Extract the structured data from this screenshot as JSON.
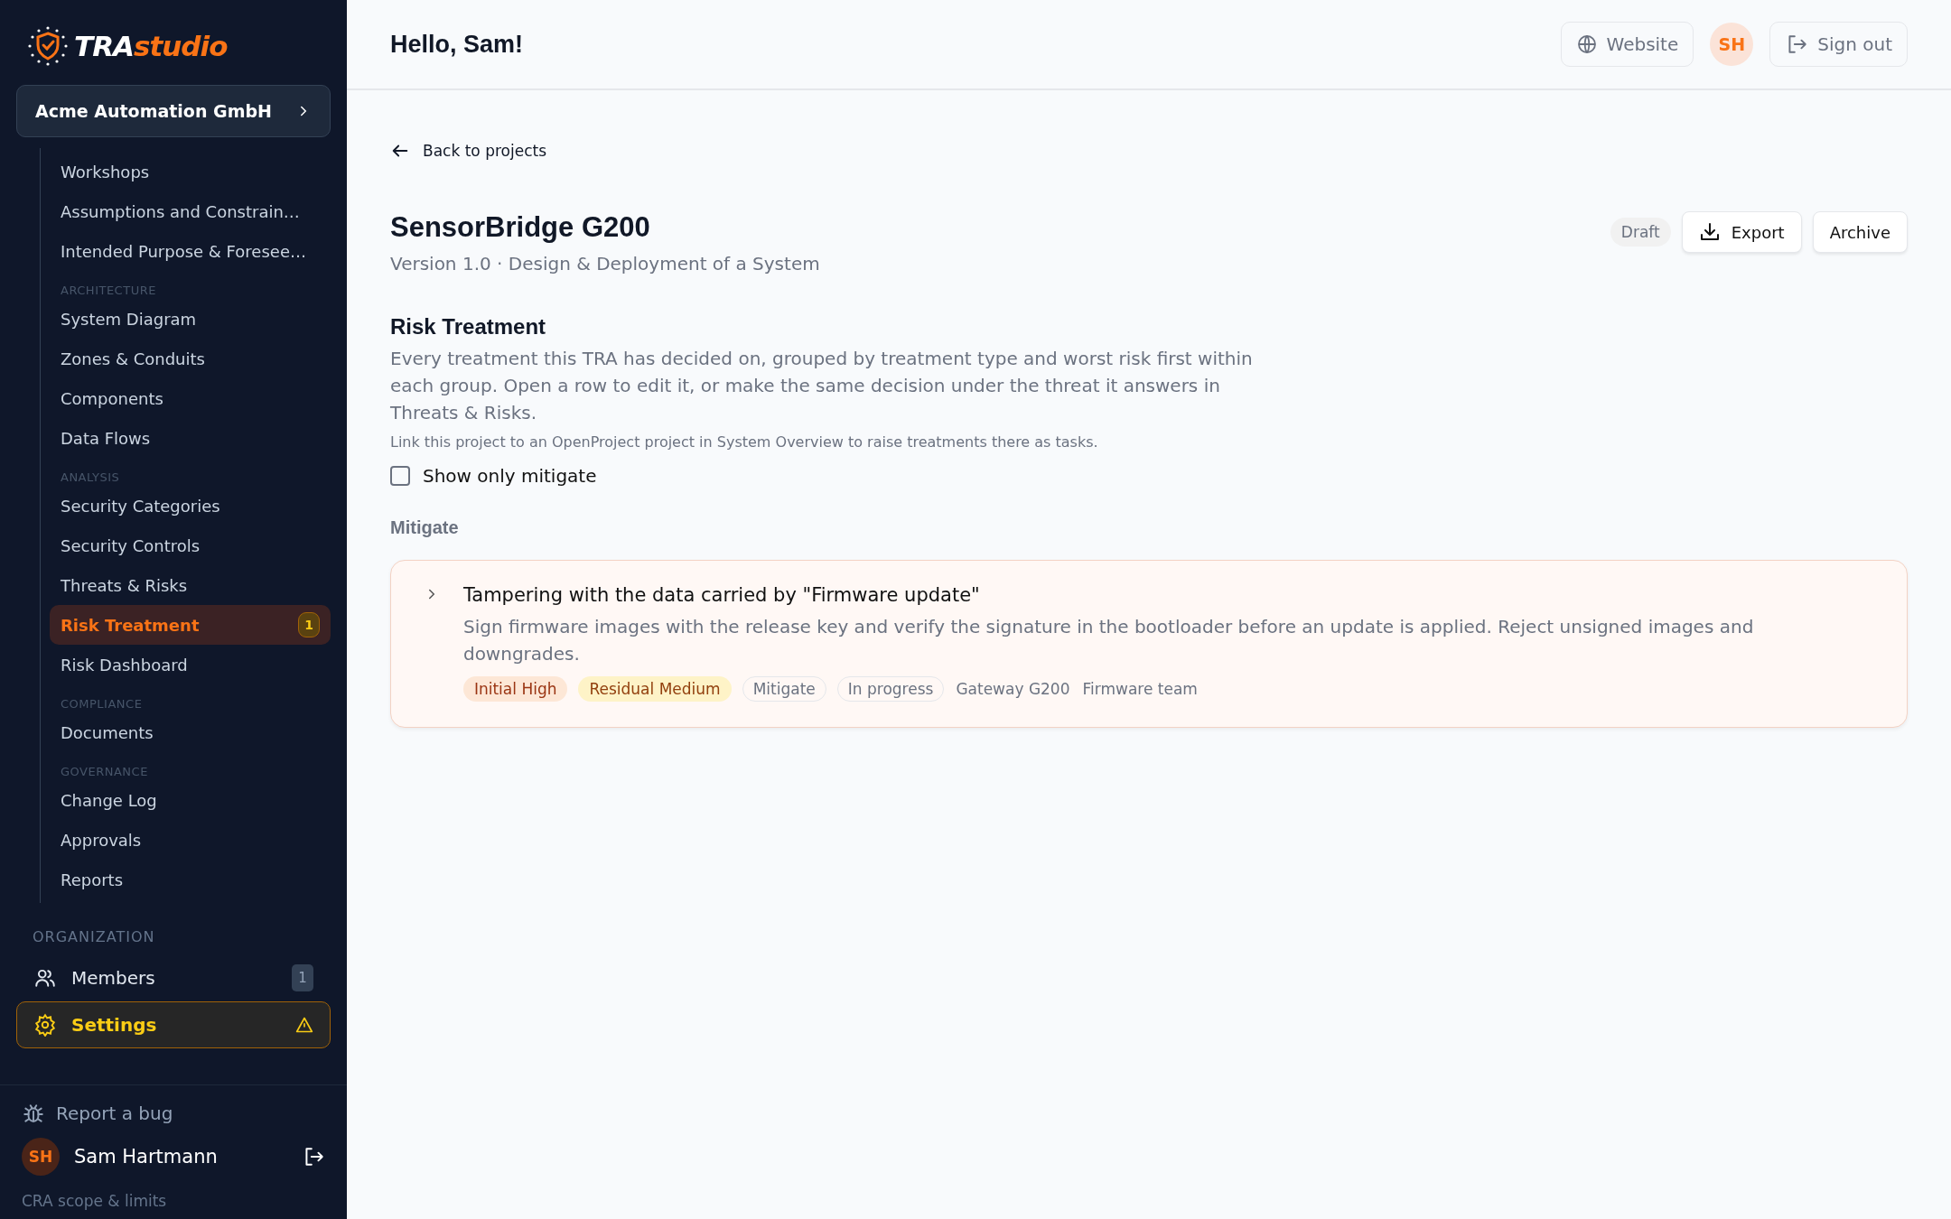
{
  "brand": {
    "part1": "TRA",
    "part2": "studio"
  },
  "org_switcher": {
    "label": "Acme Automation GmbH"
  },
  "project_nav": [
    {
      "kind": "item",
      "label": "Workshops",
      "selected": false
    },
    {
      "kind": "item",
      "label": "Assumptions and Constrain…",
      "selected": false
    },
    {
      "kind": "item",
      "label": "Intended Purpose & Foresee…",
      "selected": false
    },
    {
      "kind": "heading",
      "label": "ARCHITECTURE"
    },
    {
      "kind": "item",
      "label": "System Diagram",
      "selected": false
    },
    {
      "kind": "item",
      "label": "Zones & Conduits",
      "selected": false
    },
    {
      "kind": "item",
      "label": "Components",
      "selected": false
    },
    {
      "kind": "item",
      "label": "Data Flows",
      "selected": false
    },
    {
      "kind": "heading",
      "label": "ANALYSIS"
    },
    {
      "kind": "item",
      "label": "Security Categories",
      "selected": false
    },
    {
      "kind": "item",
      "label": "Security Controls",
      "selected": false
    },
    {
      "kind": "item",
      "label": "Threats & Risks",
      "selected": false
    },
    {
      "kind": "item",
      "label": "Risk Treatment",
      "selected": true,
      "badge": "1"
    },
    {
      "kind": "item",
      "label": "Risk Dashboard",
      "selected": false
    },
    {
      "kind": "heading",
      "label": "COMPLIANCE"
    },
    {
      "kind": "item",
      "label": "Documents",
      "selected": false
    },
    {
      "kind": "heading",
      "label": "GOVERNANCE"
    },
    {
      "kind": "item",
      "label": "Change Log",
      "selected": false
    },
    {
      "kind": "item",
      "label": "Approvals",
      "selected": false
    },
    {
      "kind": "item",
      "label": "Reports",
      "selected": false
    }
  ],
  "organization": {
    "heading": "ORGANIZATION",
    "items": [
      {
        "kind": "members",
        "label": "Members",
        "badge": "1",
        "highlighted": false
      },
      {
        "kind": "settings",
        "label": "Settings",
        "highlighted": true
      }
    ]
  },
  "sidebar_footer": {
    "report_bug": "Report a bug",
    "user": {
      "initials": "SH",
      "name": "Sam Hartmann"
    },
    "link": "CRA scope & limits"
  },
  "header": {
    "greeting": "Hello, Sam!",
    "website": "Website",
    "avatar": "SH",
    "sign_out": "Sign out"
  },
  "back_link": "Back to projects",
  "project": {
    "title": "SensorBridge G200",
    "subtitle": "Version 1.0 · Design & Deployment of a System",
    "status": "Draft",
    "actions": [
      {
        "kind": "export",
        "label": "Export"
      },
      {
        "kind": "plain",
        "label": "Archive"
      }
    ]
  },
  "section": {
    "title": "Risk Treatment",
    "description": "Every treatment this TRA has decided on, grouped by treatment type and worst risk first within each group. Open a row to edit it, or make the same decision under the threat it answers in Threats & Risks.",
    "note": "Link this project to an OpenProject project in System Overview to raise treatments there as tasks.",
    "filter": {
      "label": "Show only mitigate",
      "checked": false
    }
  },
  "groups": [
    {
      "title": "Mitigate",
      "items": [
        {
          "title": "Tampering with the data carried by \"Firmware update\"",
          "description": "Sign firmware images with the release key and verify the signature in the bootloader before an update is applied. Reject unsigned images and downgrades.",
          "expanded": false,
          "tags": [
            {
              "kind": "initial",
              "label": "Initial High"
            },
            {
              "kind": "residual",
              "label": "Residual Medium"
            },
            {
              "kind": "outline",
              "label": "Mitigate"
            },
            {
              "kind": "outline",
              "label": "In progress"
            },
            {
              "kind": "plain",
              "label": "Gateway G200"
            },
            {
              "kind": "plain",
              "label": "Firmware team"
            }
          ]
        }
      ]
    }
  ]
}
